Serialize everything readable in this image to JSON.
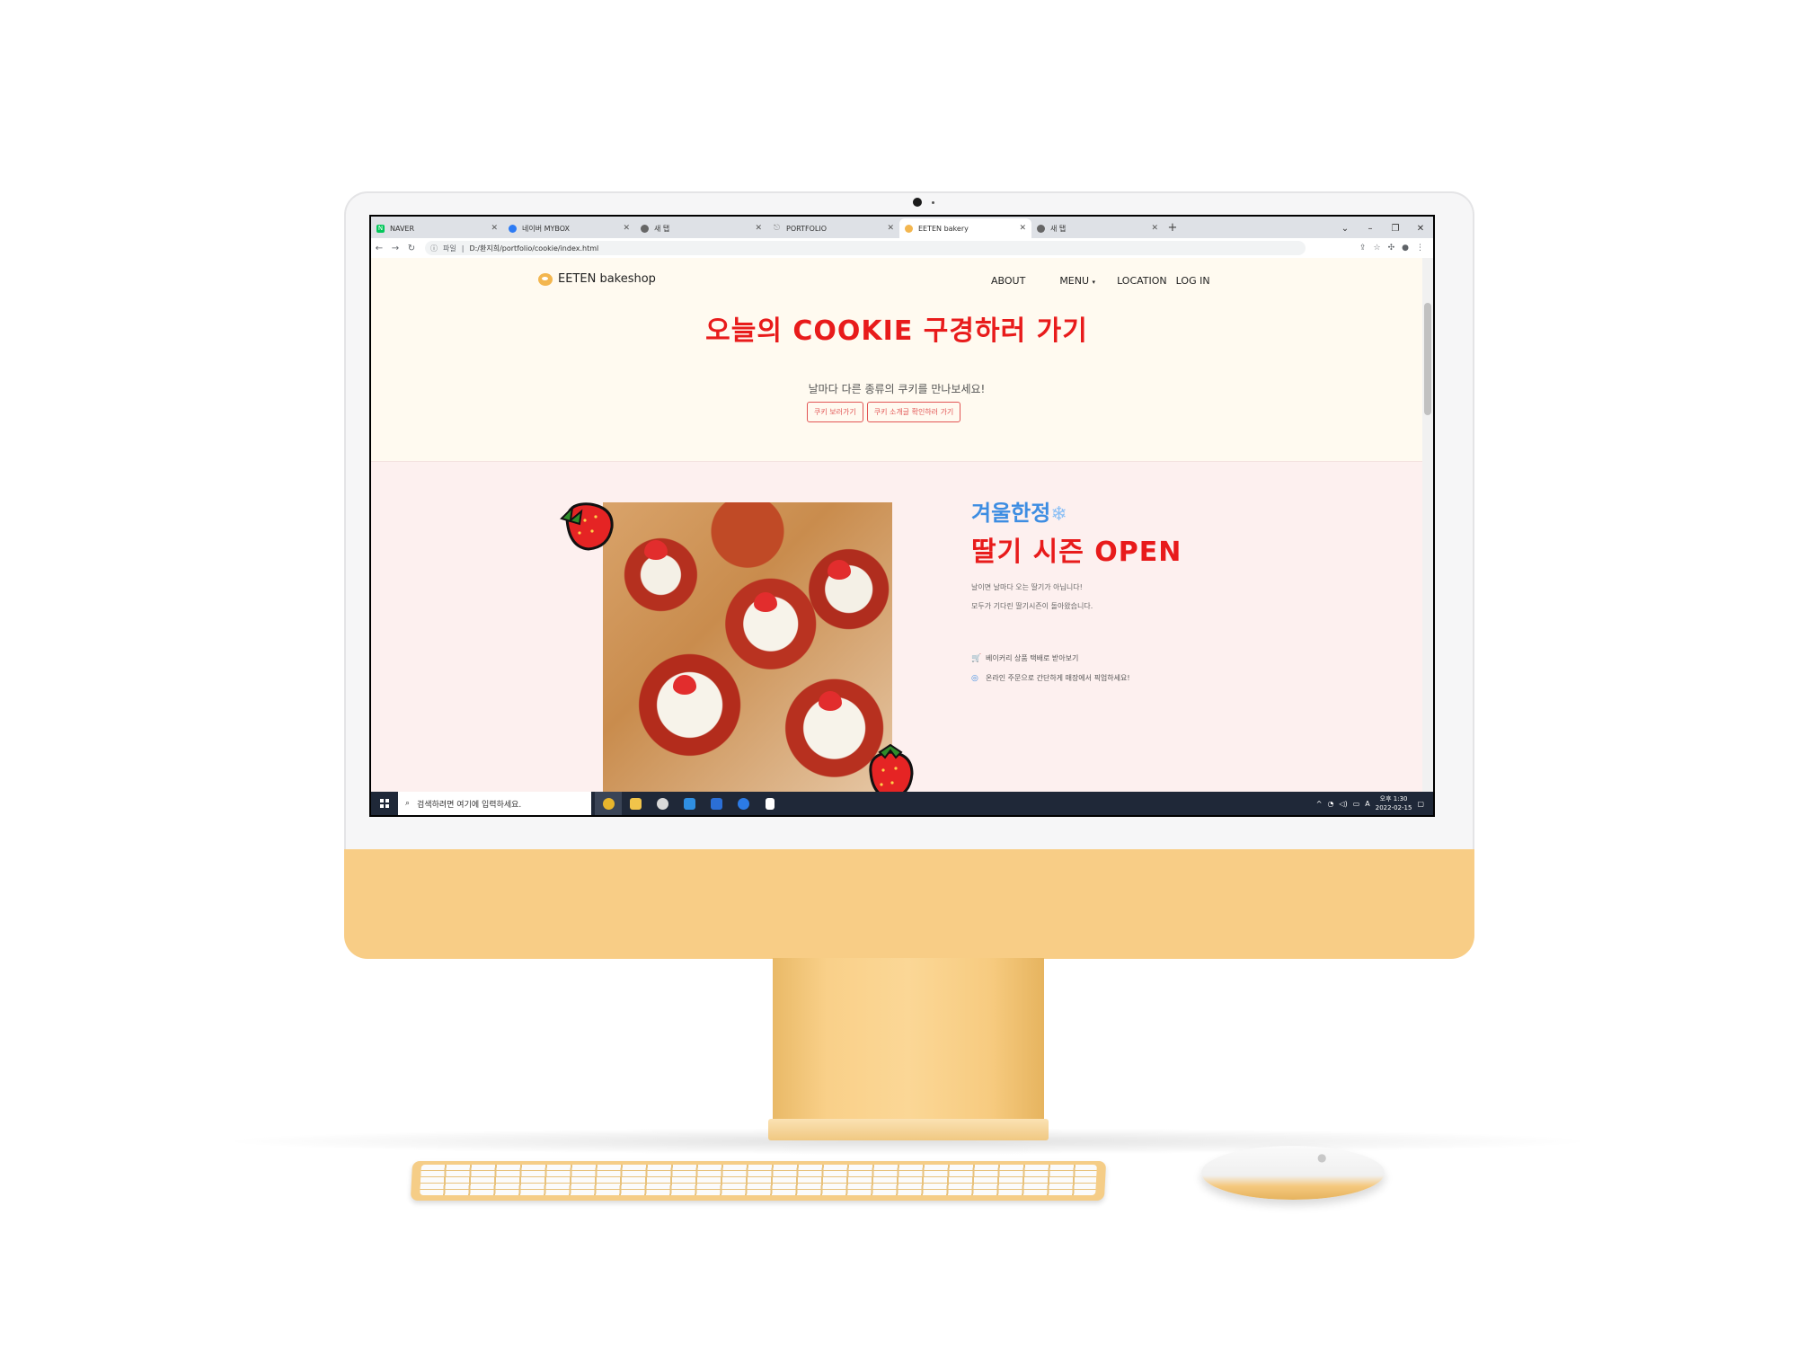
{
  "browser": {
    "tabs": [
      {
        "label": "NAVER",
        "icon": "naver-icon",
        "color": "#03c75a",
        "active": false
      },
      {
        "label": "네이버 MYBOX",
        "icon": "mybox-icon",
        "color": "#2d7bf4",
        "active": false
      },
      {
        "label": "새 탭",
        "icon": "chrome-icon",
        "color": "#666666",
        "active": false
      },
      {
        "label": "PORTFOLIO",
        "icon": "link-icon",
        "color": "#888888",
        "active": false
      },
      {
        "label": "EETEN bakery",
        "icon": "cookie-icon",
        "color": "#f3b64f",
        "active": true
      },
      {
        "label": "새 탭",
        "icon": "chrome-icon",
        "color": "#666666",
        "active": false
      }
    ],
    "address": {
      "security_label": "파일",
      "url": "D:/환지희/portfolio/cookie/index.html"
    }
  },
  "site": {
    "brand": "EETEN bakeshop",
    "nav": {
      "about": "ABOUT",
      "menu": "MENU",
      "location": "LOCATION",
      "login": "LOG IN"
    },
    "hero": {
      "title": "오늘의 COOKIE 구경하러 가기",
      "subtitle": "날마다 다른 종류의 쿠키를 만나보세요!",
      "button1": "쿠키 보러가기",
      "button2": "쿠키 소개글 확인하러 가기"
    },
    "promo": {
      "kicker": "겨울한정",
      "title": "딸기 시즌 OPEN",
      "line1": "날이면 날마다 오는 딸기가 아닙니다!",
      "line2": "모두가 기다린 딸기시즌이 돌아왔습니다.",
      "item1": "베이커리 상품 택배로 받아보기",
      "item2": "온라인 주문으로 간단하게 매장에서 픽업하세요!"
    }
  },
  "taskbar": {
    "search_placeholder": "검색하려면 여기에 입력하세요.",
    "time": "오후 1:30",
    "date": "2022-02-15",
    "ime": "A",
    "apps": [
      {
        "name": "chrome-app",
        "color": "#e8b52c"
      },
      {
        "name": "file-explorer-app",
        "color": "#f1c44a"
      },
      {
        "name": "edge-app",
        "color": "#d9d9d9"
      },
      {
        "name": "vscode-app",
        "color": "#2f8fe2"
      },
      {
        "name": "app-blue",
        "color": "#2b6fd6"
      },
      {
        "name": "app-navy",
        "color": "#2c7be5"
      },
      {
        "name": "notepad-app",
        "color": "#ffffff"
      }
    ]
  }
}
